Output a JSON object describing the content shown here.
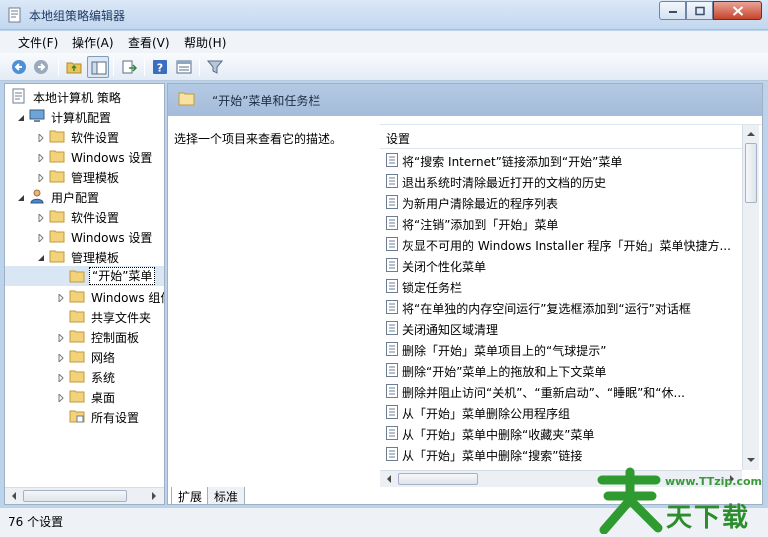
{
  "window": {
    "title": "本地组策略编辑器"
  },
  "menu": {
    "items": [
      "文件(F)",
      "操作(A)",
      "查看(V)",
      "帮助(H)"
    ]
  },
  "toolbar": {
    "buttons": [
      "back-icon",
      "forward-icon",
      "up-folder-icon",
      "show-hide-tree-icon",
      "export-list-icon",
      "help-icon",
      "properties-icon",
      "filter-icon"
    ]
  },
  "tree": {
    "root": "本地计算机 策略",
    "computer_config": "计算机配置",
    "cc_software": "软件设置",
    "cc_windows": "Windows 设置",
    "cc_admin": "管理模板",
    "user_config": "用户配置",
    "uc_software": "软件设置",
    "uc_windows": "Windows 设置",
    "uc_admin": "管理模板",
    "start_menu": "“开始”菜单",
    "windows_components": "Windows 组件",
    "shared_folders": "共享文件夹",
    "control_panel": "控制面板",
    "network": "网络",
    "system": "系统",
    "desktop": "桌面",
    "all_settings": "所有设置"
  },
  "right": {
    "header_title": "“开始”菜单和任务栏",
    "description": "选择一个项目来查看它的描述。",
    "column_header": "设置",
    "items": [
      "将“搜索 Internet”链接添加到“开始”菜单",
      "退出系统时清除最近打开的文档的历史",
      "为新用户清除最近的程序列表",
      "将“注销”添加到「开始」菜单",
      "灰显不可用的 Windows Installer 程序「开始」菜单快捷方...",
      "关闭个性化菜单",
      "锁定任务栏",
      "将“在单独的内存空间运行”复选框添加到“运行”对话框",
      "关闭通知区域清理",
      "删除「开始」菜单项目上的“气球提示”",
      "删除“开始”菜单上的拖放和上下文菜单",
      "删除并阻止访问“关机”、“重新启动”、“睡眠”和“休...",
      "从「开始」菜单删除公用程序组",
      "从「开始」菜单中删除“收藏夹”菜单",
      "从「开始」菜单中删除“搜索”链接"
    ]
  },
  "tabs": [
    "扩展",
    "标准"
  ],
  "status": {
    "text": "76 个设置"
  },
  "watermark": {
    "url": "www.TTzip.com",
    "text": "天下载"
  }
}
